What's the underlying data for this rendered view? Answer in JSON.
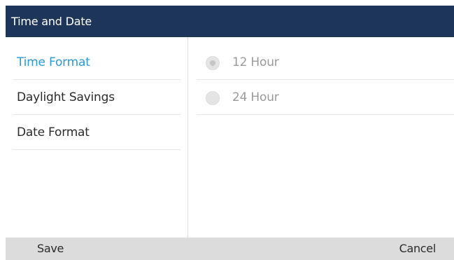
{
  "header": {
    "title": "Time and Date",
    "background": "#1c3559"
  },
  "menu": {
    "selected_color": "#2a9ad9",
    "items": [
      {
        "label": "Time Format",
        "selected": true
      },
      {
        "label": "Daylight Savings",
        "selected": false
      },
      {
        "label": "Date Format",
        "selected": false
      }
    ]
  },
  "options": {
    "items": [
      {
        "label": "12 Hour",
        "checked": true,
        "icon": "radio-checked-icon"
      },
      {
        "label": "24 Hour",
        "checked": false,
        "icon": "radio-unchecked-icon"
      }
    ]
  },
  "softkeys": {
    "save_label": "Save",
    "cancel_label": "Cancel"
  }
}
